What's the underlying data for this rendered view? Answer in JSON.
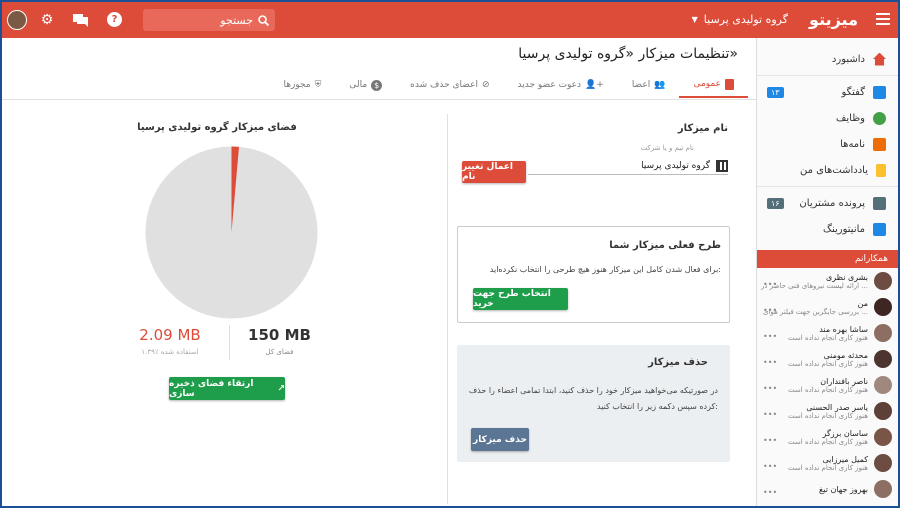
{
  "app": {
    "name": "میزیتو",
    "org": "گروه تولیدی پرسیا"
  },
  "search": {
    "placeholder": "جستجو"
  },
  "page": {
    "title": "تنظیمات میزکار «گروه تولیدی پرسیا»"
  },
  "tabs": [
    {
      "label": "عمومی"
    },
    {
      "label": "اعضا"
    },
    {
      "label": "دعوت عضو جدید"
    },
    {
      "label": "اعضای حذف شده"
    },
    {
      "label": "مالی"
    },
    {
      "label": "مجوزها"
    }
  ],
  "name_section": {
    "title": "نام میزکار",
    "field_label": "نام تیم و یا شرکت",
    "field_value": "گروه تولیدی پرسیا",
    "apply_button": "اعمال تغییر نام"
  },
  "plan_section": {
    "title": "طرح فعلی میزکار شما",
    "text": "برای فعال شدن کامل این میزکار هنوز هیچ طرحی را انتخاب نکرده‌اید:",
    "button": "انتخاب طرح جهت خرید"
  },
  "delete_section": {
    "title": "حذف میزکار",
    "text": "در صورتیکه می‌خواهید میزکار خود را حذف کنید، ابتدا تمامی اعضاء را حذف کرده سپس دکمه زیر را انتخاب کنید:",
    "button": "حذف میزکار"
  },
  "storage": {
    "title": "فضای میزکار گروه تولیدی پرسیا",
    "total": "150 MB",
    "total_label": "فضای کل",
    "used": "2.09 MB",
    "used_label": "۱.۳۹٪ استفاده شده",
    "used_fraction": 0.0139,
    "upgrade_button": "ارتقاء فضای ذخیره سازی"
  },
  "sidebar": {
    "items": [
      {
        "label": "داشبورد",
        "icon": "home-icon",
        "color": "#dd4b39",
        "badge": ""
      },
      {
        "label": "گفتگو",
        "icon": "chat-icon",
        "color": "#1e88e5",
        "badge": "۱۳"
      },
      {
        "label": "وظایف",
        "icon": "task-icon",
        "color": "#43a047",
        "badge": ""
      },
      {
        "label": "نامه‌ها",
        "icon": "mail-icon",
        "color": "#ef6c00",
        "badge": ""
      },
      {
        "label": "یادداشت‌های من",
        "icon": "note-icon",
        "color": "#fbc02d",
        "badge": ""
      },
      {
        "label": "پرونده مشتریان",
        "icon": "customer-icon",
        "color": "#546e7a",
        "badge": "۱۶"
      },
      {
        "label": "مانیتورینگ",
        "icon": "chart-icon",
        "color": "#1e88e5",
        "badge": ""
      }
    ],
    "contacts_header": "همکارانم",
    "contacts": [
      {
        "name": "بشری نظری",
        "status": "ارائه لیست نیروهای فنی حاضر در ..."
      },
      {
        "name": "من",
        "status": "بررسی جایگزین جهت فیلتر هوای ..."
      },
      {
        "name": "ساشا بهره مند",
        "status": "هنوز کاری انجام نداده است"
      },
      {
        "name": "محدثه مومنی",
        "status": "هنوز کاری انجام نداده است"
      },
      {
        "name": "ناصر بافنداران",
        "status": "هنوز کاری انجام نداده است"
      },
      {
        "name": "یاسر صدر الحسنی",
        "status": "هنوز کاری انجام نداده است"
      },
      {
        "name": "ساسان برزگر",
        "status": "هنوز کاری انجام نداده است"
      },
      {
        "name": "کمیل میرزایی",
        "status": "هنوز کاری انجام نداده است"
      },
      {
        "name": "بهروز جهان تیغ",
        "status": ""
      }
    ]
  }
}
